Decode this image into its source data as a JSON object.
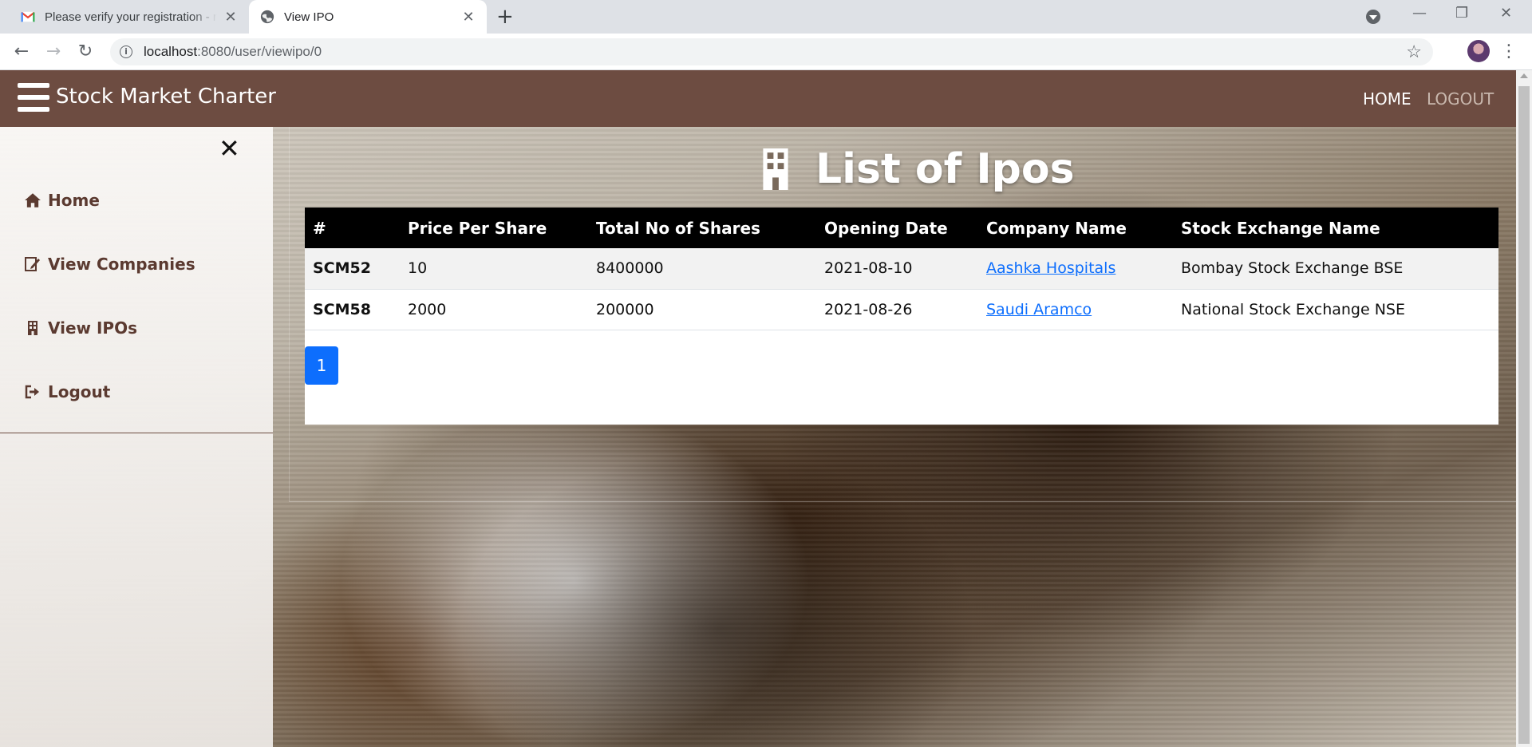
{
  "browser": {
    "tabs": [
      {
        "title": "Please verify your registration - n",
        "favicon": "gmail-icon",
        "active": false
      },
      {
        "title": "View IPO",
        "favicon": "globe-icon",
        "active": true
      }
    ],
    "url_host": "localhost",
    "url_path": ":8080/user/viewipo/0"
  },
  "navbar": {
    "brand": "Stock Market Charter",
    "links": {
      "home": "HOME",
      "logout": "LOGOUT"
    },
    "color": "#6d4c41"
  },
  "sidebar": {
    "close_glyph": "✕",
    "items": [
      {
        "label": "Home",
        "icon": "home-icon"
      },
      {
        "label": "View Companies",
        "icon": "edit-icon"
      },
      {
        "label": "View IPOs",
        "icon": "building-icon"
      },
      {
        "label": "Logout",
        "icon": "sign-out-icon"
      }
    ]
  },
  "main": {
    "title": "List of Ipos",
    "title_icon": "building-icon",
    "table": {
      "headers": [
        "#",
        "Price Per Share",
        "Total No of Shares",
        "Opening Date",
        "Company Name",
        "Stock Exchange Name"
      ],
      "rows": [
        {
          "id": "SCM52",
          "price": "10",
          "shares": "8400000",
          "date": "2021-08-10",
          "company": "Aashka Hospitals",
          "exchange": "Bombay Stock Exchange BSE"
        },
        {
          "id": "SCM58",
          "price": "2000",
          "shares": "200000",
          "date": "2021-08-26",
          "company": "Saudi Aramco",
          "exchange": "National Stock Exchange NSE"
        }
      ]
    },
    "pagination": {
      "current": "1",
      "color": "#0d6efd"
    }
  }
}
